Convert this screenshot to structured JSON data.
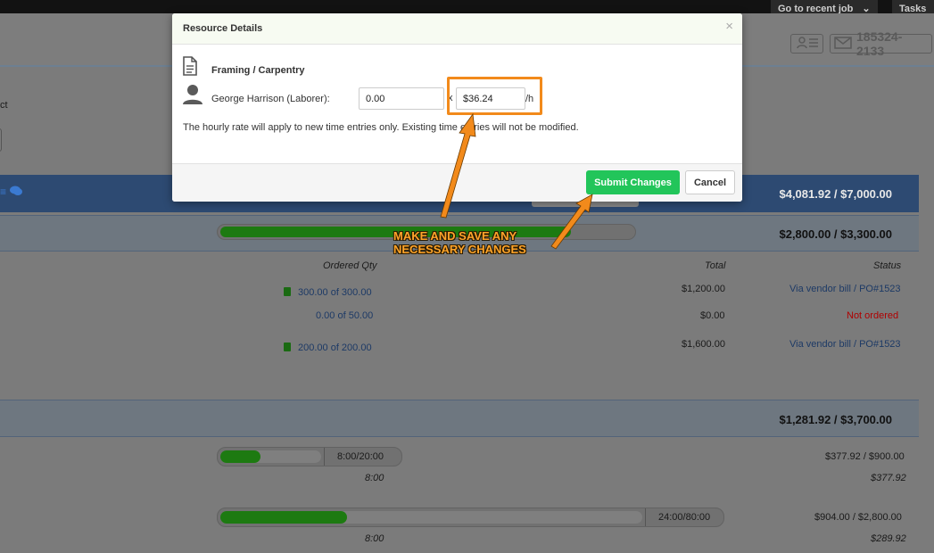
{
  "topbar": {
    "recent_job_label": "Go to recent job",
    "tasks_label": "Tasks"
  },
  "header": {
    "contact_number": "185324-2133",
    "partial_text": "ct"
  },
  "modal": {
    "title": "Resource Details",
    "close_glyph": "×",
    "section_title": "Framing / Carpentry",
    "resource_label": "George Harrison (Laborer):",
    "hours_value": "0.00",
    "multiply_symbol": "x",
    "rate_value": "$36.24",
    "rate_unit": "/h",
    "note": "The hourly rate will apply to new time entries only. Existing time entries will not be modified.",
    "submit_label": "Submit Changes",
    "cancel_label": "Cancel"
  },
  "annotation": {
    "line1": "MAKE AND SAVE ANY",
    "line2": "NECESSARY CHANGES",
    "color": "#f28a1b"
  },
  "budget": {
    "section1_total": "$4,081.92 / $7,000.00",
    "materials_total": "$2,800.00 / $3,300.00",
    "materials_progress": 0.85,
    "columns": {
      "ordered_qty": "Ordered Qty",
      "total": "Total",
      "status": "Status"
    },
    "rows": [
      {
        "qty": "300.00 of 300.00",
        "total": "$1,200.00",
        "status": "Via vendor bill / PO#1523"
      },
      {
        "qty": "0.00 of 50.00",
        "total": "$0.00",
        "status": "Not ordered"
      },
      {
        "qty": "200.00 of 200.00",
        "total": "$1,600.00",
        "status": "Via vendor bill / PO#1523"
      }
    ],
    "labor_total": "$1,281.92 / $3,700.00",
    "labor_items": [
      {
        "hours": "8:00/20:00",
        "progress": 0.4,
        "amount": "$377.92 / $900.00",
        "sub_hours": "8:00",
        "sub_amount": "$377.92"
      },
      {
        "hours": "24:00/80:00",
        "progress": 0.3,
        "amount": "$904.00 / $2,800.00",
        "sub_hours": "8:00",
        "sub_amount": "$289.92"
      }
    ]
  },
  "colors": {
    "submit": "#22c55a",
    "accent_dark": "#2d4a72",
    "progress": "#1d7a11",
    "not_ordered": "#b00000"
  }
}
